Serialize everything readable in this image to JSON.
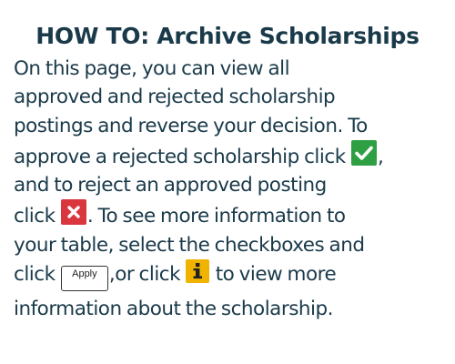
{
  "title": "HOW TO: Archive Scholarships",
  "instructions": {
    "line1": "On this page, you can view all",
    "line2": "approved and rejected scholarship",
    "line3": "postings and reverse your decision. To",
    "line4a": "approve a rejected scholarship click ",
    "line4b": ",",
    "line5": "and to reject an approved posting",
    "line6a": "click ",
    "line6b": ". To see more information to",
    "line7": "your table, select the checkboxes and",
    "line8a": "click ",
    "line8b": ",or click ",
    "line8c": " to view more",
    "line9": "information about the scholarship."
  },
  "apply_button": {
    "label": "Apply"
  },
  "icons": {
    "approve": "check-icon",
    "reject": "x-icon",
    "info": "info-icon"
  },
  "colors": {
    "text": "#1a3a4a",
    "approve": "#2ea043",
    "reject": "#d9363e",
    "info": "#f0b400"
  }
}
